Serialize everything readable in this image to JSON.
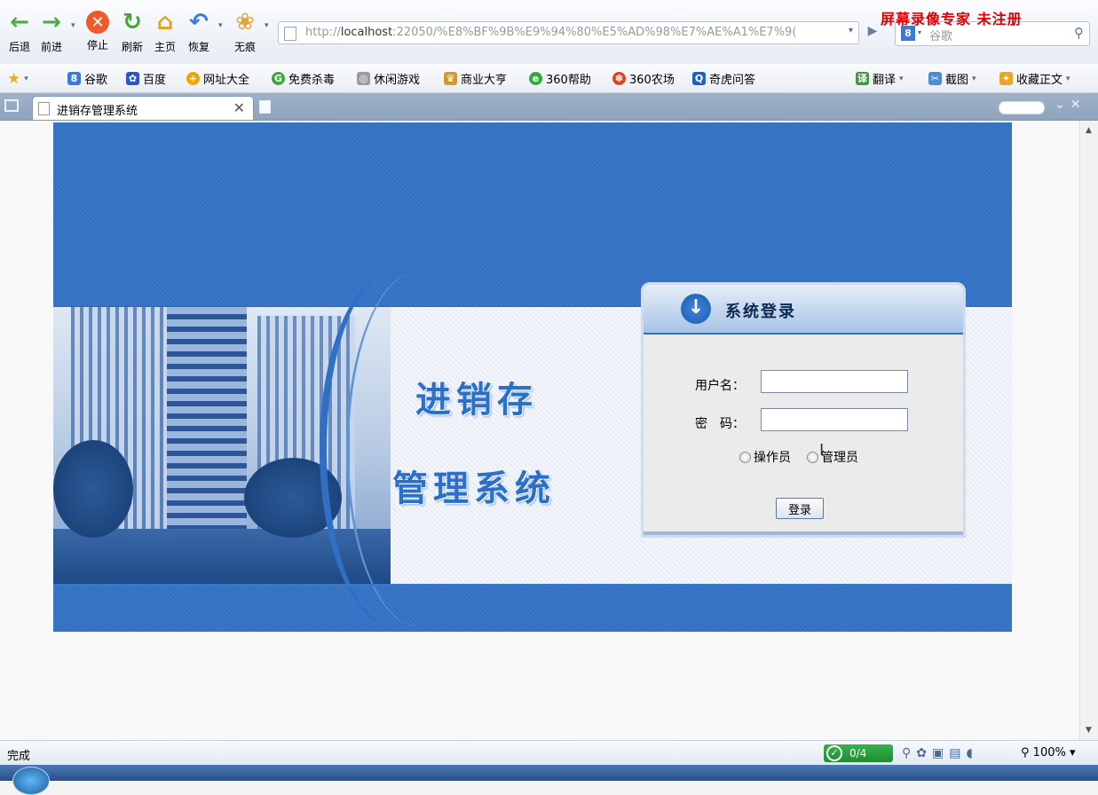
{
  "toolbar": {
    "back": "后退",
    "forward": "前进",
    "stop": "停止",
    "refresh": "刷新",
    "home": "主页",
    "restore": "恢复",
    "incognito": "无痕"
  },
  "address": {
    "url_prefix": "http://",
    "url_host": "localhost",
    "url_rest": ":22050/%E8%BF%9B%E9%94%80%E5%AD%98%E7%AE%A1%E7%9("
  },
  "search": {
    "placeholder": "谷歌"
  },
  "watermark": "屏幕录像专家  未注册",
  "bookmarks": {
    "items": [
      "谷歌",
      "百度",
      "网址大全",
      "免费杀毒",
      "休闲游戏",
      "商业大亨",
      "360帮助",
      "360农场",
      "奇虎问答"
    ],
    "right": [
      "翻译",
      "截图",
      "收藏正文"
    ]
  },
  "tab": {
    "title": "进销存管理系统"
  },
  "page": {
    "title_line1": "进销存",
    "title_line2": "管理系统",
    "panel_title": "系统登录",
    "username_label": "用户名：",
    "password_label": "密　码：",
    "radio_operator": "操作员",
    "radio_admin": "管理员",
    "login_button": "登录",
    "username_value": "",
    "password_value": ""
  },
  "status": {
    "text": "完成",
    "progress": "0/4",
    "zoom": "100%"
  },
  "colors": {
    "banner_blue": "#3470c2",
    "title_blue": "#2b6fc6",
    "watermark_red": "#e00000",
    "status_green": "#1f8c33"
  }
}
